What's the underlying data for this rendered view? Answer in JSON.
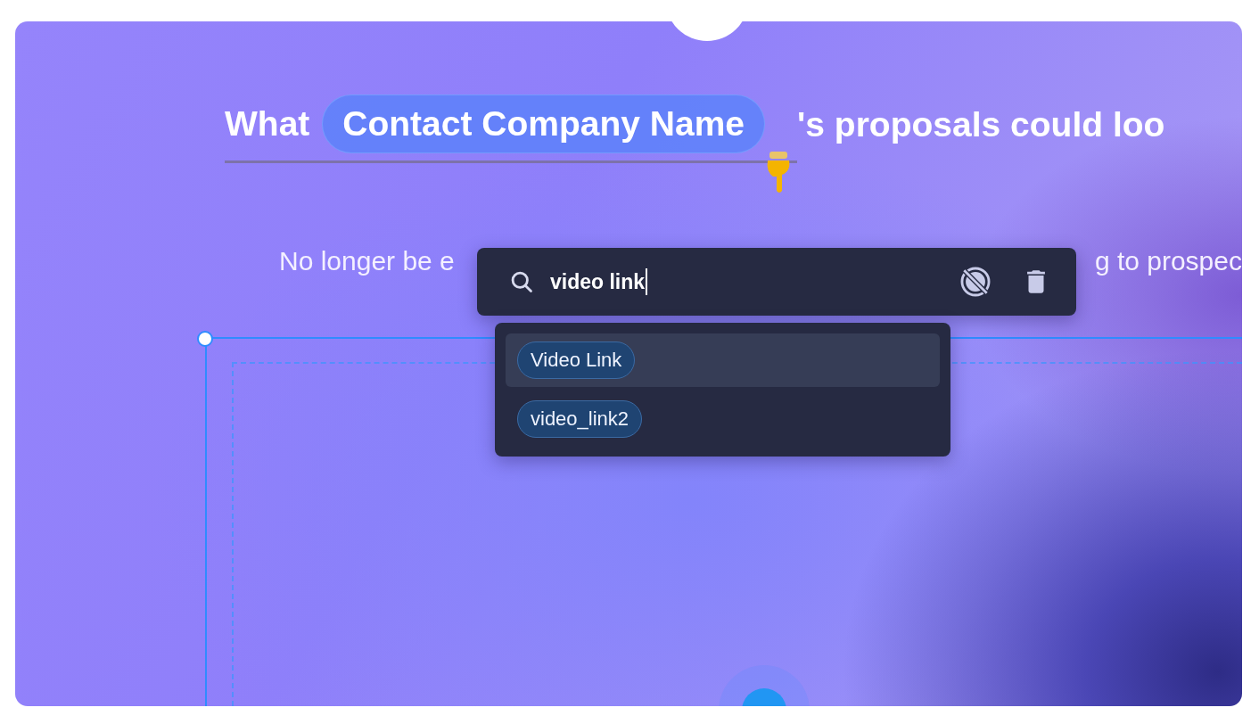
{
  "headline": {
    "before": "What",
    "token": "Contact Company Name",
    "after": "'s proposals could loo"
  },
  "subtitle": {
    "visible_start": "No longer be e",
    "visible_end": "g to prospec"
  },
  "search": {
    "value": "video link"
  },
  "results": [
    {
      "label": "Video Link",
      "selected": true
    },
    {
      "label": "video_link2",
      "selected": false
    }
  ]
}
